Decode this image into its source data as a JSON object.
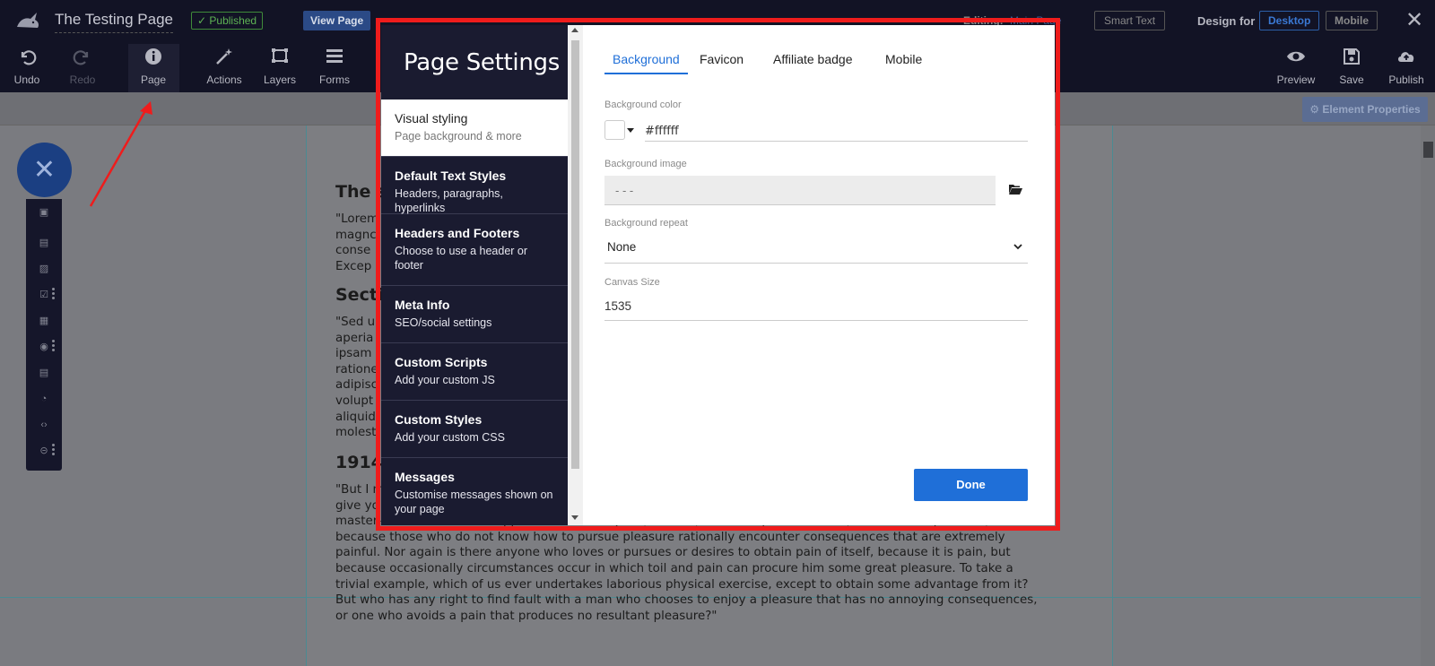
{
  "header": {
    "page_title": "The Testing Page",
    "published_badge": "✓ Published",
    "view_page": "View Page",
    "editing_label": "Editing:",
    "editing_value": "Main Page",
    "smart_text": "Smart Text",
    "design_for": "Design for",
    "desktop": "Desktop",
    "mobile": "Mobile"
  },
  "toolbar": {
    "undo": "Undo",
    "redo": "Redo",
    "page": "Page",
    "actions": "Actions",
    "layers": "Layers",
    "forms": "Forms",
    "preview": "Preview",
    "save": "Save",
    "publish": "Publish"
  },
  "subbar": {
    "element_properties": "⚙ Element Properties"
  },
  "canvas": {
    "heading1": "The st",
    "para1": [
      "\"Lorem",
      "magnc",
      "conse",
      "Excep"
    ],
    "heading2": "Sectio",
    "para2": [
      "\"Sed u",
      "aperia",
      "ipsam",
      "ratione",
      "adipisc",
      "volupt",
      "aliquid",
      "molest"
    ],
    "heading3": "1914",
    "para3": [
      "\"But I m",
      "give yo",
      "master-builder of human happiness. No one rejects, dislikes, or avoids pleasure itself, because it is pleasure, but",
      "because those who do not know how to pursue pleasure rationally encounter consequences that are extremely",
      "painful. Nor again is there anyone who loves or pursues or desires to obtain pain of itself, because it is pain, but",
      "because occasionally circumstances occur in which toil and pain can procure him some great pleasure. To take a",
      "trivial example, which of us ever undertakes laborious physical exercise, except to obtain some advantage from it?",
      "But who has any right to find fault with a man who chooses to enjoy a pleasure that has no annoying consequences,",
      "or one who avoids a pain that produces no resultant pleasure?\""
    ]
  },
  "modal": {
    "title": "Page Settings",
    "nav": [
      {
        "title": "Visual styling",
        "subtitle": "Page background & more"
      },
      {
        "title": "Default Text Styles",
        "subtitle": "Headers, paragraphs, hyperlinks"
      },
      {
        "title": "Headers and Footers",
        "subtitle": "Choose to use a header or footer"
      },
      {
        "title": "Meta Info",
        "subtitle": "SEO/social settings"
      },
      {
        "title": "Custom Scripts",
        "subtitle": "Add your custom JS"
      },
      {
        "title": "Custom Styles",
        "subtitle": "Add your custom CSS"
      },
      {
        "title": "Messages",
        "subtitle": "Customise messages shown on your page"
      }
    ],
    "tabs": [
      "Background",
      "Favicon",
      "Affiliate badge",
      "Mobile"
    ],
    "fields": {
      "bg_color_label": "Background color",
      "bg_color_value": "#ffffff",
      "bg_image_label": "Background image",
      "bg_image_placeholder": "- - -",
      "bg_repeat_label": "Background repeat",
      "bg_repeat_value": "None",
      "canvas_size_label": "Canvas Size",
      "canvas_size_value": "1535"
    },
    "done": "Done"
  },
  "colors": {
    "accent": "#1f6fd8",
    "annotation": "#ef1c1c",
    "sidebar_bg": "#1a1b30"
  }
}
